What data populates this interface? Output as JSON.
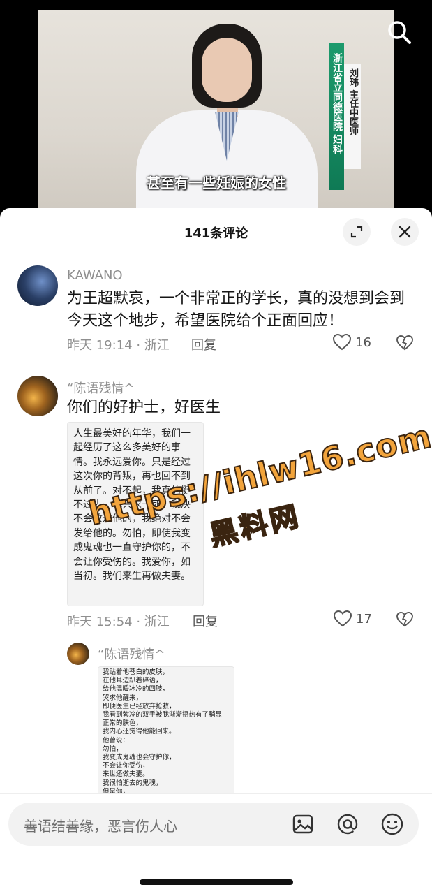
{
  "video": {
    "subtitle": "甚至有一些妊娠的女性",
    "hospital_vertical": "浙江省立同德医院 妇科",
    "doctor_vertical": "刘玮 主任中医师"
  },
  "comments_header": {
    "title": "141条评论"
  },
  "comments": [
    {
      "username": "KAWANO",
      "text": "为王超默哀，一个非常正的学长，真的没想到会到今天这个地步，希望医院给个正面回应！",
      "time_location": "昨天 19:14 · 浙江",
      "reply_label": "回复",
      "likes": "16"
    },
    {
      "username": "“陈语残情^",
      "text": "你们的好护士，好医生",
      "image_text": "人生最美好的年华，我们一起经历了这么多美好的事情。我永远爱你。只是经过这次你的背叛，再也回不到从前了。对不起，我真的挺不过去，我只求一死，我决不会放过他的，我绝对不会发给他的。勿怕，即使我变成鬼魂也一直守护你的，不会让你受伤的。我爱你，如当初。我们来生再做夫妻。",
      "time_location": "昨天 15:54 · 浙江",
      "reply_label": "回复",
      "likes": "17"
    }
  ],
  "reply": {
    "username": "“陈语残情^",
    "image_lines": [
      "我贴着他苍白的皮肤，",
      "在他耳边趴着碎语，",
      "给他温暖冰冷的四肢，",
      "哭求他醒来，",
      "即便医生已经放弃抢救，",
      "我看到紫冷的双手被我渐渐捂热有了稍显",
      "正常的肤色，",
      "我内心还觉得他能回来。",
      "他曾说：",
      "勿怕，",
      "我变成鬼魂也会守护你，",
      "不会让你受伤，",
      "来世还做夫妻。",
      "我很怕逝去的鬼魂，",
      "但是你，",
      "我不怕！"
    ]
  },
  "watermark": {
    "url": "https://ihlw16.com",
    "name": "黑料网"
  },
  "input": {
    "placeholder": "善语结善缘，恶言伤人心"
  },
  "icons": {
    "search": "search-icon",
    "expand": "expand-icon",
    "close": "close-icon",
    "heart": "heart-icon",
    "broken_heart": "broken-heart-icon",
    "image": "image-icon",
    "at": "at-icon",
    "emoji": "emoji-icon"
  },
  "colors": {
    "accent_green": "#1c9a6c",
    "watermark_orange": "#f2a43c"
  }
}
